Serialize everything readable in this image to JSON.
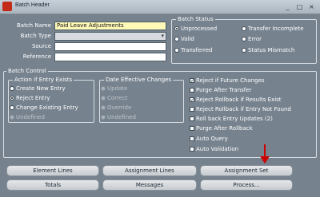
{
  "window": {
    "title": "Batch Header",
    "controls": [
      "_",
      "□",
      "×"
    ]
  },
  "header_fields": {
    "batch_name": {
      "label": "Batch Name",
      "value": "Paid Leave Adjustments"
    },
    "batch_type": {
      "label": "Batch Type",
      "value": ""
    },
    "source": {
      "label": "Source",
      "value": ""
    },
    "reference": {
      "label": "Reference",
      "value": ""
    }
  },
  "batch_status": {
    "title": "Batch Status",
    "options": [
      {
        "label": "Unprocessed",
        "selected": true
      },
      {
        "label": "Transfer Incomplete",
        "selected": false
      },
      {
        "label": "Valid",
        "selected": false
      },
      {
        "label": "Error",
        "selected": false
      },
      {
        "label": "Transferred",
        "selected": false
      },
      {
        "label": "Status Mismatch",
        "selected": false
      }
    ]
  },
  "batch_control": {
    "title": "Batch Control",
    "action_group": {
      "title": "Action if Entry Exists",
      "options": [
        {
          "label": "Create New Entry",
          "selected": false,
          "disabled": false
        },
        {
          "label": "Reject Entry",
          "selected": true,
          "disabled": false
        },
        {
          "label": "Change Existing Entry",
          "selected": false,
          "disabled": false
        },
        {
          "label": "Undefined",
          "selected": false,
          "disabled": true
        }
      ]
    },
    "date_group": {
      "title": "Date Effective Changes",
      "options": [
        {
          "label": "Update",
          "disabled": true
        },
        {
          "label": "Correct",
          "disabled": true
        },
        {
          "label": "Override",
          "disabled": true
        },
        {
          "label": "Undefined",
          "disabled": true
        }
      ]
    },
    "checkboxes": [
      {
        "label": "Reject if Future Changes",
        "checked": true
      },
      {
        "label": "Purge After Transfer",
        "checked": false
      },
      {
        "label": "Reject Rollback if Results Exist",
        "checked": true
      },
      {
        "label": "Reject Rollback if Entry Not Found",
        "checked": false
      },
      {
        "label": "Roll back Entry Updates (2)",
        "checked": false
      },
      {
        "label": "Purge After Rollback",
        "checked": false
      },
      {
        "label": "Auto Query",
        "checked": false
      },
      {
        "label": "Auto Validation",
        "checked": false
      }
    ]
  },
  "buttons": {
    "element_lines": "Element Lines",
    "assignment_lines": "Assignment Lines",
    "assignment_set": "Assignment Set",
    "totals": "Totals",
    "messages": "Messages",
    "process": "Process..."
  },
  "colors": {
    "form_background": "#76828e",
    "required_field": "#fff9b8",
    "annotation_arrow": "#cc0000"
  }
}
